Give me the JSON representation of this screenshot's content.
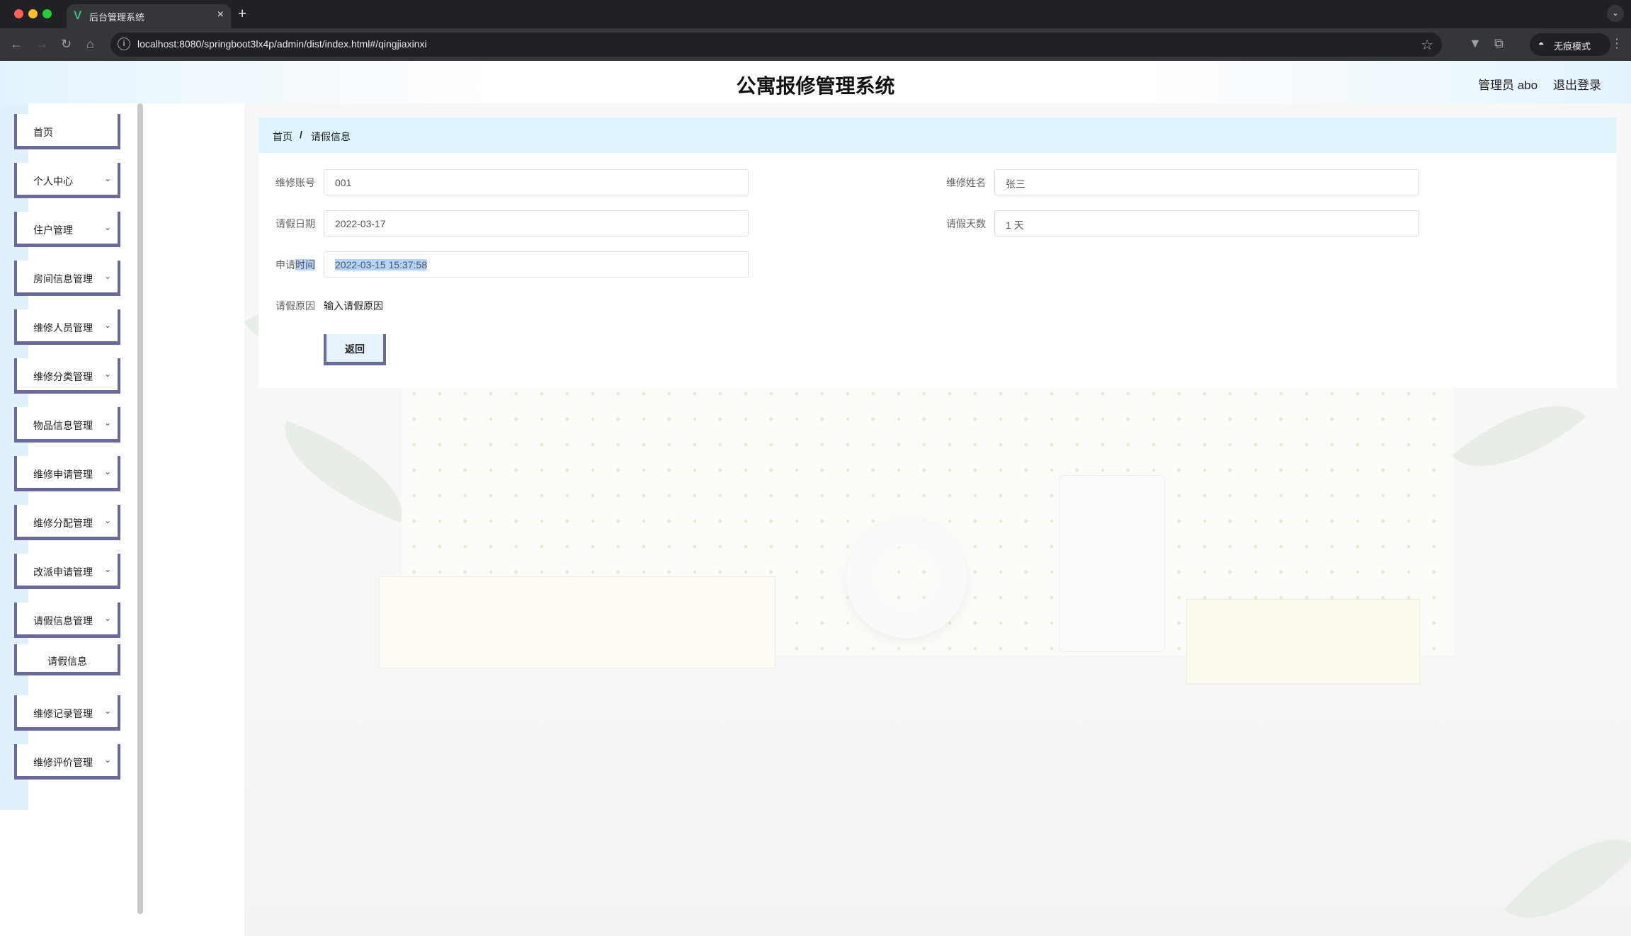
{
  "browser": {
    "tab_title": "后台管理系统",
    "url": "localhost:8080/springboot3lx4p/admin/dist/index.html#/qingjiaxinxi",
    "incognito_label": "无痕模式"
  },
  "header": {
    "title": "公寓报修管理系统",
    "user_label": "管理员 abo",
    "logout_label": "退出登录"
  },
  "sidebar": {
    "items": [
      {
        "label": "首页"
      },
      {
        "label": "个人中心"
      },
      {
        "label": "住户管理"
      },
      {
        "label": "房间信息管理"
      },
      {
        "label": "维修人员管理"
      },
      {
        "label": "维修分类管理"
      },
      {
        "label": "物品信息管理"
      },
      {
        "label": "维修申请管理"
      },
      {
        "label": "维修分配管理"
      },
      {
        "label": "改派申请管理"
      },
      {
        "label": "请假信息管理"
      },
      {
        "label": "维修记录管理"
      },
      {
        "label": "维修评价管理"
      }
    ],
    "subitem": {
      "label": "请假信息"
    }
  },
  "breadcrumb": {
    "home": "首页",
    "separator": "/",
    "current": "请假信息"
  },
  "form": {
    "repair_account": {
      "label": "维修账号",
      "value": "001"
    },
    "repair_name": {
      "label": "维修姓名",
      "value": "张三"
    },
    "leave_date": {
      "label": "请假日期",
      "value": "2022-03-17"
    },
    "leave_days": {
      "label": "请假天数",
      "value": "1 天"
    },
    "apply_time": {
      "label_prefix": "申请",
      "label_highlight": "时间",
      "value": "2022-03-15 15:37:58"
    },
    "reason": {
      "label": "请假原因",
      "value": "输入请假原因"
    },
    "back_button": "返回"
  }
}
